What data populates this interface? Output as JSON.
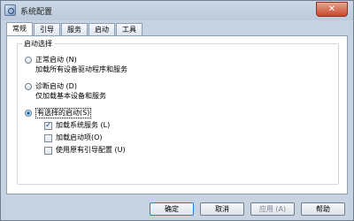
{
  "window": {
    "title": "系统配置",
    "close_symbol": "✕"
  },
  "tabs": [
    "常规",
    "引导",
    "服务",
    "启动",
    "工具"
  ],
  "active_tab": "常规",
  "startup_group": {
    "title": "启动选择",
    "options": [
      {
        "label": "正常启动 (N)",
        "description": "加载所有设备驱动程序和服务",
        "selected": false
      },
      {
        "label": "诊断启动 (D)",
        "description": "仅加载基本设备和服务",
        "selected": false
      },
      {
        "label": "有选择的启动(S)",
        "selected": true
      }
    ],
    "selective_items": [
      {
        "label": "加载系统服务 (L)",
        "checked": true
      },
      {
        "label": "加载启动项(O)",
        "checked": false
      },
      {
        "label": "使用原有引导配置 (U)",
        "checked": false
      }
    ]
  },
  "buttons": {
    "ok": "确定",
    "cancel": "取消",
    "apply": "应用 (A)",
    "help": "帮助"
  },
  "icons": {
    "app": "system-config-icon",
    "close": "close-icon"
  }
}
